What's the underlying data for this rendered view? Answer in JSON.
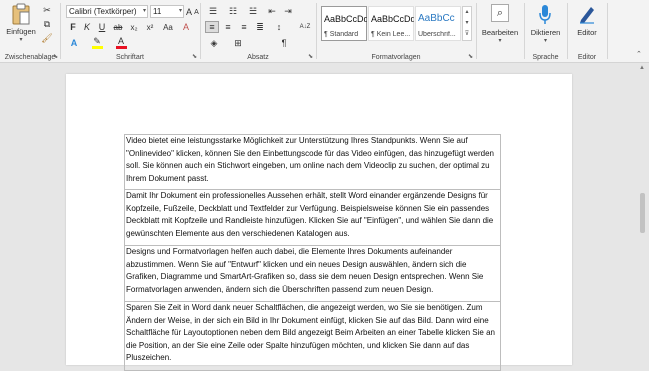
{
  "ribbon": {
    "clipboard": {
      "paste_label": "Einfügen",
      "group_label": "Zwischenablage"
    },
    "font": {
      "name": "Calibri (Textkörper)",
      "size": "11",
      "bold": "F",
      "italic": "K",
      "underline": "U",
      "strike": "ab",
      "sub": "x₂",
      "sup": "x²",
      "grow": "A",
      "shrink": "A",
      "case": "Aa",
      "clear": "A",
      "color": "A",
      "group_label": "Schriftart"
    },
    "paragraph": {
      "sort": "A↓Z",
      "pilcrow": "¶",
      "group_label": "Absatz"
    },
    "styles": {
      "items": [
        {
          "sample": "AaBbCcDd",
          "name": "¶ Standard"
        },
        {
          "sample": "AaBbCcDd",
          "name": "¶ Kein Lee..."
        },
        {
          "sample": "AaBbCc",
          "name": "Überschrif..."
        }
      ],
      "group_label": "Formatvorlagen"
    },
    "editing": {
      "label": "Bearbeiten"
    },
    "voice": {
      "label": "Diktieren",
      "group_label": "Sprache"
    },
    "editor": {
      "label": "Editor",
      "group_label": "Editor"
    }
  },
  "document": {
    "cells": [
      "Video bietet eine leistungsstarke Möglichkeit zur Unterstützung Ihres Standpunkts. Wenn Sie auf \"Onlinevideo\" klicken, können Sie den Einbettungscode für das Video einfügen, das hinzugefügt werden soll. Sie können auch ein Stichwort eingeben, um online nach dem Videoclip zu suchen, der optimal zu Ihrem Dokument passt.",
      "Damit Ihr Dokument ein professionelles Aussehen erhält, stellt Word einander ergänzende Designs für Kopfzeile, Fußzeile, Deckblatt und Textfelder zur Verfügung. Beispielsweise können Sie ein passendes Deckblatt mit Kopfzeile und Randleiste hinzufügen. Klicken Sie auf \"Einfügen\", und wählen Sie dann die gewünschten Elemente aus den verschiedenen Katalogen aus.",
      "Designs und Formatvorlagen helfen auch dabei, die Elemente Ihres Dokuments aufeinander abzustimmen. Wenn Sie auf \"Entwurf\" klicken und ein neues Design auswählen, ändern sich die Grafiken, Diagramme und SmartArt-Grafiken so, dass sie dem neuen Design entsprechen. Wenn Sie Formatvorlagen anwenden, ändern sich die Überschriften passend zum neuen Design.",
      "Sparen Sie Zeit in Word dank neuer Schaltflächen, die angezeigt werden, wo Sie sie benötigen. Zum Ändern der Weise, in der sich ein Bild in Ihr Dokument einfügt, klicken Sie auf das Bild. Dann wird eine Schaltfläche für Layoutoptionen neben dem Bild angezeigt Beim Arbeiten an einer Tabelle klicken Sie an die Position, an der Sie eine Zeile oder Spalte hinzufügen möchten, und klicken Sie dann auf das Pluszeichen."
    ]
  },
  "colors": {
    "highlight": "#ffff00",
    "font_color": "#e81123",
    "accent": "#2b579a",
    "mic": "#2b88d8"
  }
}
